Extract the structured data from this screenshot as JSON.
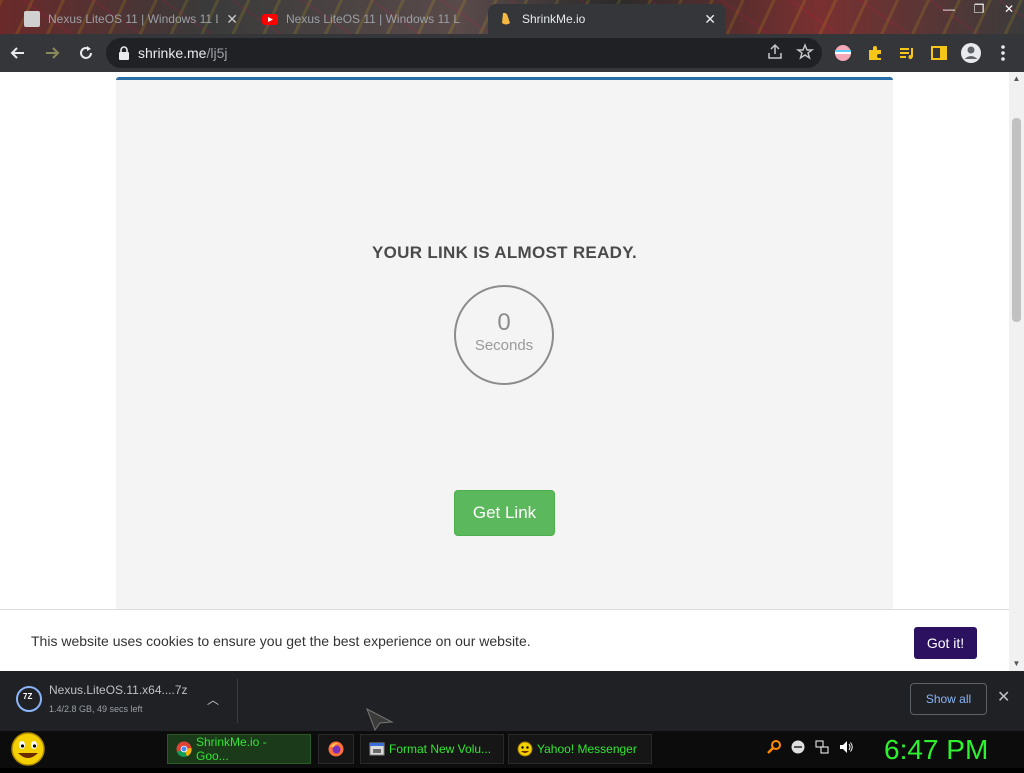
{
  "browser": {
    "tabs": [
      {
        "title": "Nexus LiteOS 11 | Windows 11 L",
        "active": false
      },
      {
        "title": "Nexus LiteOS 11 | Windows 11 L",
        "active": false
      },
      {
        "title": "ShrinkMe.io",
        "active": true
      }
    ],
    "address": {
      "host": "shrinke.me",
      "path": "/lj5j"
    }
  },
  "page": {
    "headline": "YOUR LINK IS ALMOST READY.",
    "countdown_value": "0",
    "countdown_unit": "Seconds",
    "get_link_label": "Get Link",
    "cookie_message": "This website uses cookies to ensure you get the best experience on our website.",
    "cookie_button": "Got it!"
  },
  "downloads": {
    "item": {
      "name": "Nexus.LiteOS.11.x64....7z",
      "status": "1.4/2.8 GB, 49 secs left"
    },
    "show_all": "Show all"
  },
  "taskbar": {
    "buttons": [
      {
        "label": "ShrinkMe.io - Goo..."
      },
      {
        "label": ""
      },
      {
        "label": "Format New Volu..."
      },
      {
        "label": "Yahoo! Messenger"
      }
    ],
    "clock": "6:47 PM"
  },
  "colors": {
    "accent_blue": "#2a6fa8",
    "get_link_green": "#5cb85c",
    "cookie_button": "#2b1160",
    "taskbar_text": "#31e631"
  }
}
